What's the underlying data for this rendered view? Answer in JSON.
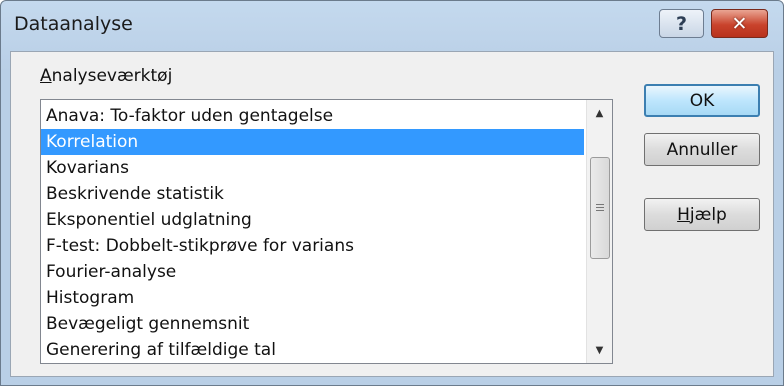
{
  "window": {
    "title": "Dataanalyse"
  },
  "titlebar": {
    "help_glyph": "?",
    "close_glyph": "✕"
  },
  "group": {
    "label_accel": "A",
    "label_rest": "nalyseværktøj"
  },
  "tools": {
    "items": [
      "Anava: To-faktor uden gentagelse",
      "Korrelation",
      "Kovarians",
      "Beskrivende statistik",
      "Eksponentiel udglatning",
      "F-test: Dobbelt-stikprøve for varians",
      "Fourier-analyse",
      "Histogram",
      "Bevægeligt gennemsnit",
      "Generering af tilfældige tal"
    ],
    "selected_index": 1
  },
  "scrollbar": {
    "up_glyph": "▲",
    "down_glyph": "▼"
  },
  "buttons": {
    "ok": "OK",
    "cancel": "Annuller",
    "help_accel": "H",
    "help_rest": "jælp"
  }
}
